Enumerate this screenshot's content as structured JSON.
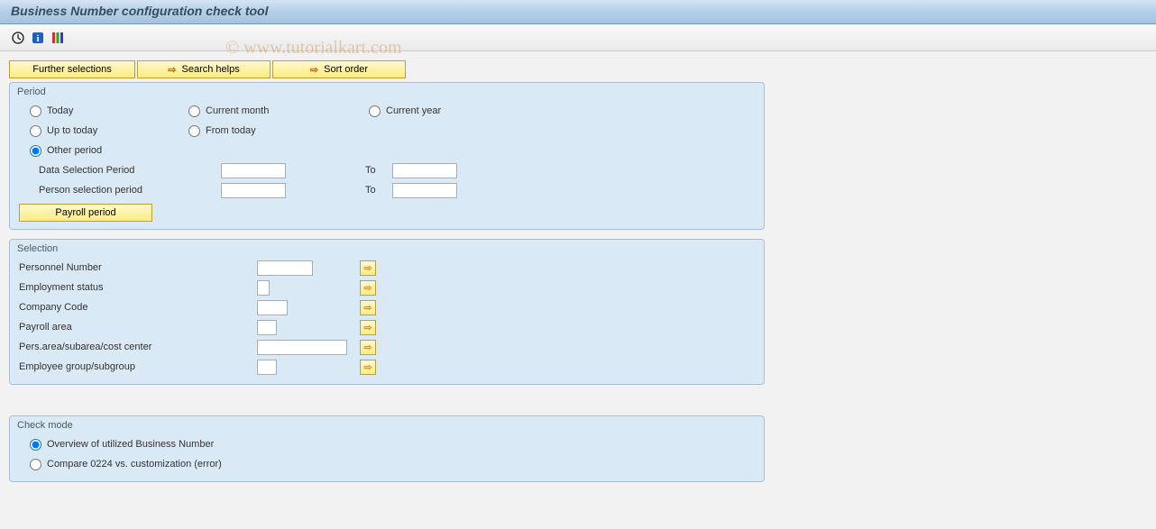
{
  "titlebar": {
    "title": "Business Number configuration check tool"
  },
  "watermark": "© www.tutorialkart.com",
  "toolbar": {
    "icons": [
      "execute-icon",
      "info-icon",
      "variant-icon"
    ]
  },
  "buttons": {
    "further_selections": "Further selections",
    "search_helps": "Search helps",
    "sort_order": "Sort order",
    "payroll_period": "Payroll period"
  },
  "period": {
    "legend": "Period",
    "today": "Today",
    "current_month": "Current month",
    "current_year": "Current year",
    "up_to_today": "Up to today",
    "from_today": "From today",
    "other_period": "Other period",
    "data_selection_period": "Data Selection Period",
    "person_selection_period": "Person selection period",
    "to": "To"
  },
  "selection": {
    "legend": "Selection",
    "rows": {
      "personnel_number": "Personnel Number",
      "employment_status": "Employment status",
      "company_code": "Company Code",
      "payroll_area": "Payroll area",
      "pers_area": "Pers.area/subarea/cost center",
      "employee_group": "Employee group/subgroup"
    }
  },
  "check_mode": {
    "legend": "Check mode",
    "overview": "Overview of utilized Business Number",
    "compare": "Compare 0224 vs. customization (error)"
  }
}
